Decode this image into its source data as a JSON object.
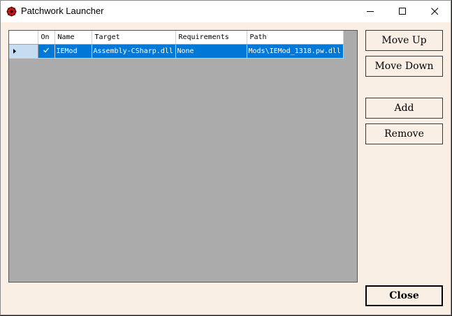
{
  "window": {
    "title": "Patchwork Launcher"
  },
  "grid": {
    "columns": [
      "On",
      "Name",
      "Target",
      "Requirements",
      "Path"
    ],
    "rows": [
      {
        "on": true,
        "name": "IEMod",
        "target": "Assembly-CSharp.dll",
        "requirements": "None",
        "path": "Mods\\IEMod_1318.pw.dll"
      }
    ]
  },
  "buttons": {
    "move_up": "Move Up",
    "move_down": "Move Down",
    "add": "Add",
    "remove": "Remove",
    "close": "Close"
  },
  "colors": {
    "selection": "#0078d7",
    "window_bg": "#faefe4",
    "grid_bg": "#ababab",
    "row_header_selected": "#c5dcf1"
  }
}
